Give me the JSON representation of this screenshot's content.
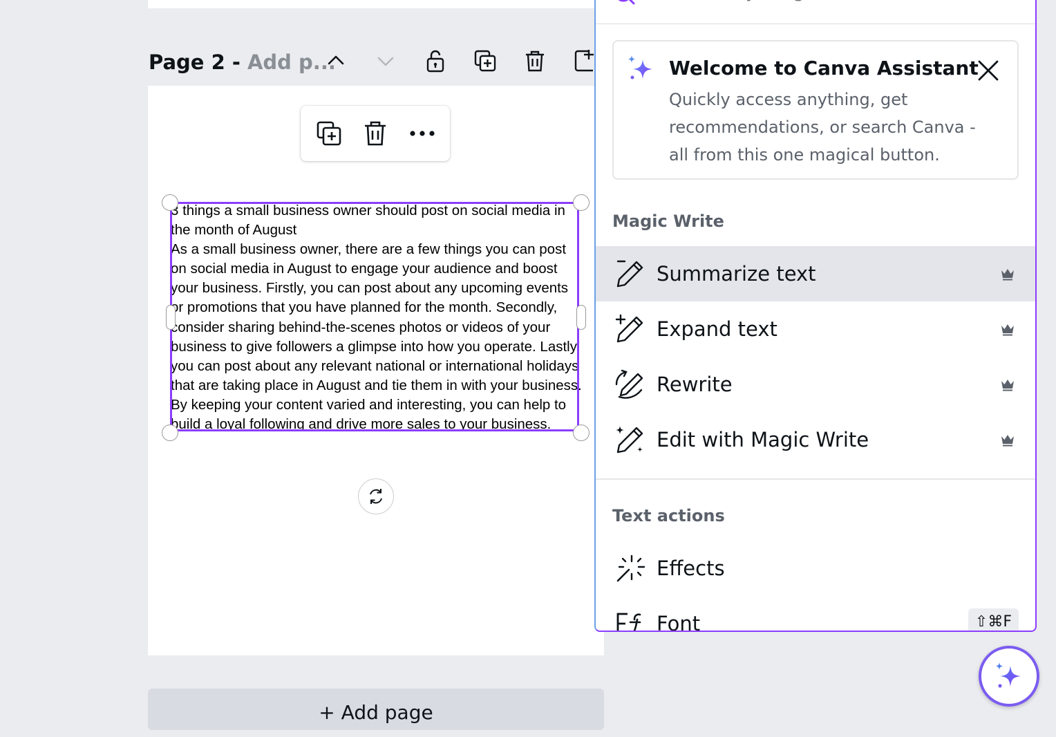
{
  "page_header": {
    "page_number": "Page 2 - ",
    "title_placeholder": "Add p..."
  },
  "textbox": {
    "content": "3 things a small business owner should post on social media in\nthe month of August\nAs a small business owner, there are a few things you can post\non social media in August to engage your audience and boost\nyour business. Firstly, you can post about any upcoming events\nor promotions that you have planned for the month. Secondly,\nconsider sharing behind-the-scenes photos or videos of your\nbusiness to give followers a glimpse into how you operate. Lastly,\nyou can post about any relevant national or international holidays\nthat are taking place in August and tie them in with your business.\nBy keeping your content varied and interesting, you can help to\nbuild a loyal following and drive more sales to your business."
  },
  "add_page_label": "+ Add page",
  "assistant": {
    "search_placeholder": "Search anything",
    "welcome_title": "Welcome to Canva Assistant",
    "welcome_body": "Quickly access anything, get recommendations, or search Canva - all from this one magical button.",
    "magic_write_label": "Magic Write",
    "magic_items": [
      {
        "label": "Summarize text",
        "icon": "pencil-lines-icon",
        "premium": true
      },
      {
        "label": "Expand text",
        "icon": "pencil-plus-icon",
        "premium": true
      },
      {
        "label": "Rewrite",
        "icon": "pencil-rewrite-icon",
        "premium": true
      },
      {
        "label": "Edit with Magic Write",
        "icon": "magic-pencil-icon",
        "premium": true
      }
    ],
    "text_actions_label": "Text actions",
    "text_items": [
      {
        "label": "Effects",
        "icon": "effects-icon"
      },
      {
        "label": "Font",
        "icon": "font-icon",
        "shortcut": "⇧⌘F"
      }
    ]
  },
  "colors": {
    "accent": "#8b3dff",
    "canvas_bg": "#ebecf0",
    "active_row": "#e3e5ea"
  }
}
